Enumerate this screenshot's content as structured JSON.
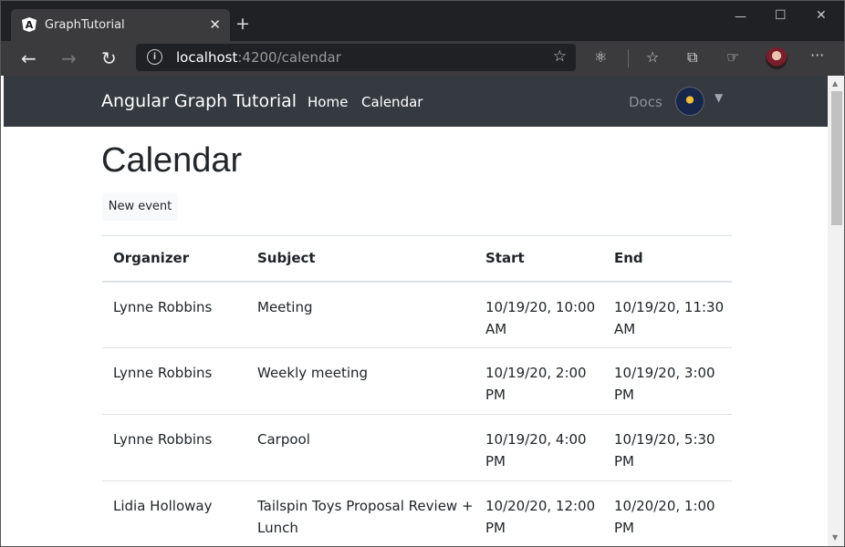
{
  "browser": {
    "tab_title": "GraphTutorial",
    "tab_favicon": "angular-logo-icon",
    "url_host": "localhost",
    "url_rest": ":4200/calendar",
    "icons": {
      "back": "arrow-left-icon",
      "forward": "arrow-right-icon",
      "refresh": "refresh-icon",
      "info": "info-icon",
      "favorite": "star-icon",
      "extension": "react-icon",
      "favorites": "favorites-list-icon",
      "collections": "collections-icon",
      "feedback": "feedback-icon",
      "profile": "profile-avatar",
      "menu": "more-icon"
    },
    "colors": {
      "tabstrip": "#202124",
      "toolbar": "#3b3b3d"
    }
  },
  "navbar": {
    "brand": "Angular Graph Tutorial",
    "links": {
      "home": "Home",
      "calendar": "Calendar",
      "docs": "Docs"
    },
    "color": "#343a40"
  },
  "page": {
    "title": "Calendar",
    "new_event_label": "New event"
  },
  "events_table": {
    "headers": {
      "organizer": "Organizer",
      "subject": "Subject",
      "start": "Start",
      "end": "End"
    },
    "rows": [
      {
        "organizer": "Lynne Robbins",
        "subject": "Meeting",
        "start": "10/19/20, 10:00 AM",
        "end": "10/19/20, 11:30 AM"
      },
      {
        "organizer": "Lynne Robbins",
        "subject": "Weekly meeting",
        "start": "10/19/20, 2:00 PM",
        "end": "10/19/20, 3:00 PM"
      },
      {
        "organizer": "Lynne Robbins",
        "subject": "Carpool",
        "start": "10/19/20, 4:00 PM",
        "end": "10/19/20, 5:30 PM"
      },
      {
        "organizer": "Lidia Holloway",
        "subject": "Tailspin Toys Proposal Review + Lunch",
        "start": "10/20/20, 12:00 PM",
        "end": "10/20/20, 1:00 PM"
      }
    ]
  }
}
